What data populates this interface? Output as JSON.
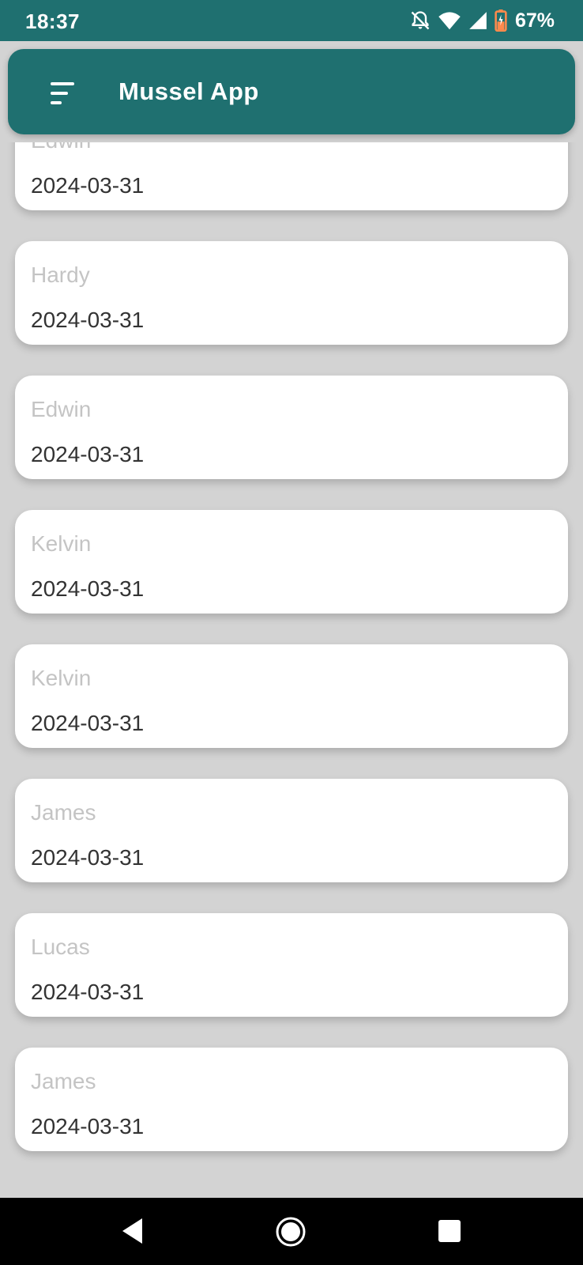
{
  "status_bar": {
    "time": "18:37",
    "battery_percent": "67%",
    "icons": [
      "notifications-off-icon",
      "wifi-icon",
      "cell-signal-icon",
      "battery-charging-icon"
    ]
  },
  "app_bar": {
    "title": "Mussel App",
    "menu_icon": "sort-menu-icon"
  },
  "colors": {
    "primary": "#1f7070",
    "background": "#d3d3d3",
    "card": "#ffffff",
    "name_text": "#c4c4c4",
    "date_text": "#333333"
  },
  "records": [
    {
      "name": "Edwin",
      "date": "2024-03-31"
    },
    {
      "name": "Hardy",
      "date": "2024-03-31"
    },
    {
      "name": "Edwin",
      "date": "2024-03-31"
    },
    {
      "name": "Kelvin",
      "date": "2024-03-31"
    },
    {
      "name": "Kelvin",
      "date": "2024-03-31"
    },
    {
      "name": "James",
      "date": "2024-03-31"
    },
    {
      "name": "Lucas",
      "date": "2024-03-31"
    },
    {
      "name": "James",
      "date": "2024-03-31"
    }
  ],
  "nav_bar": {
    "buttons": [
      "back-icon",
      "home-icon",
      "recents-icon"
    ]
  }
}
